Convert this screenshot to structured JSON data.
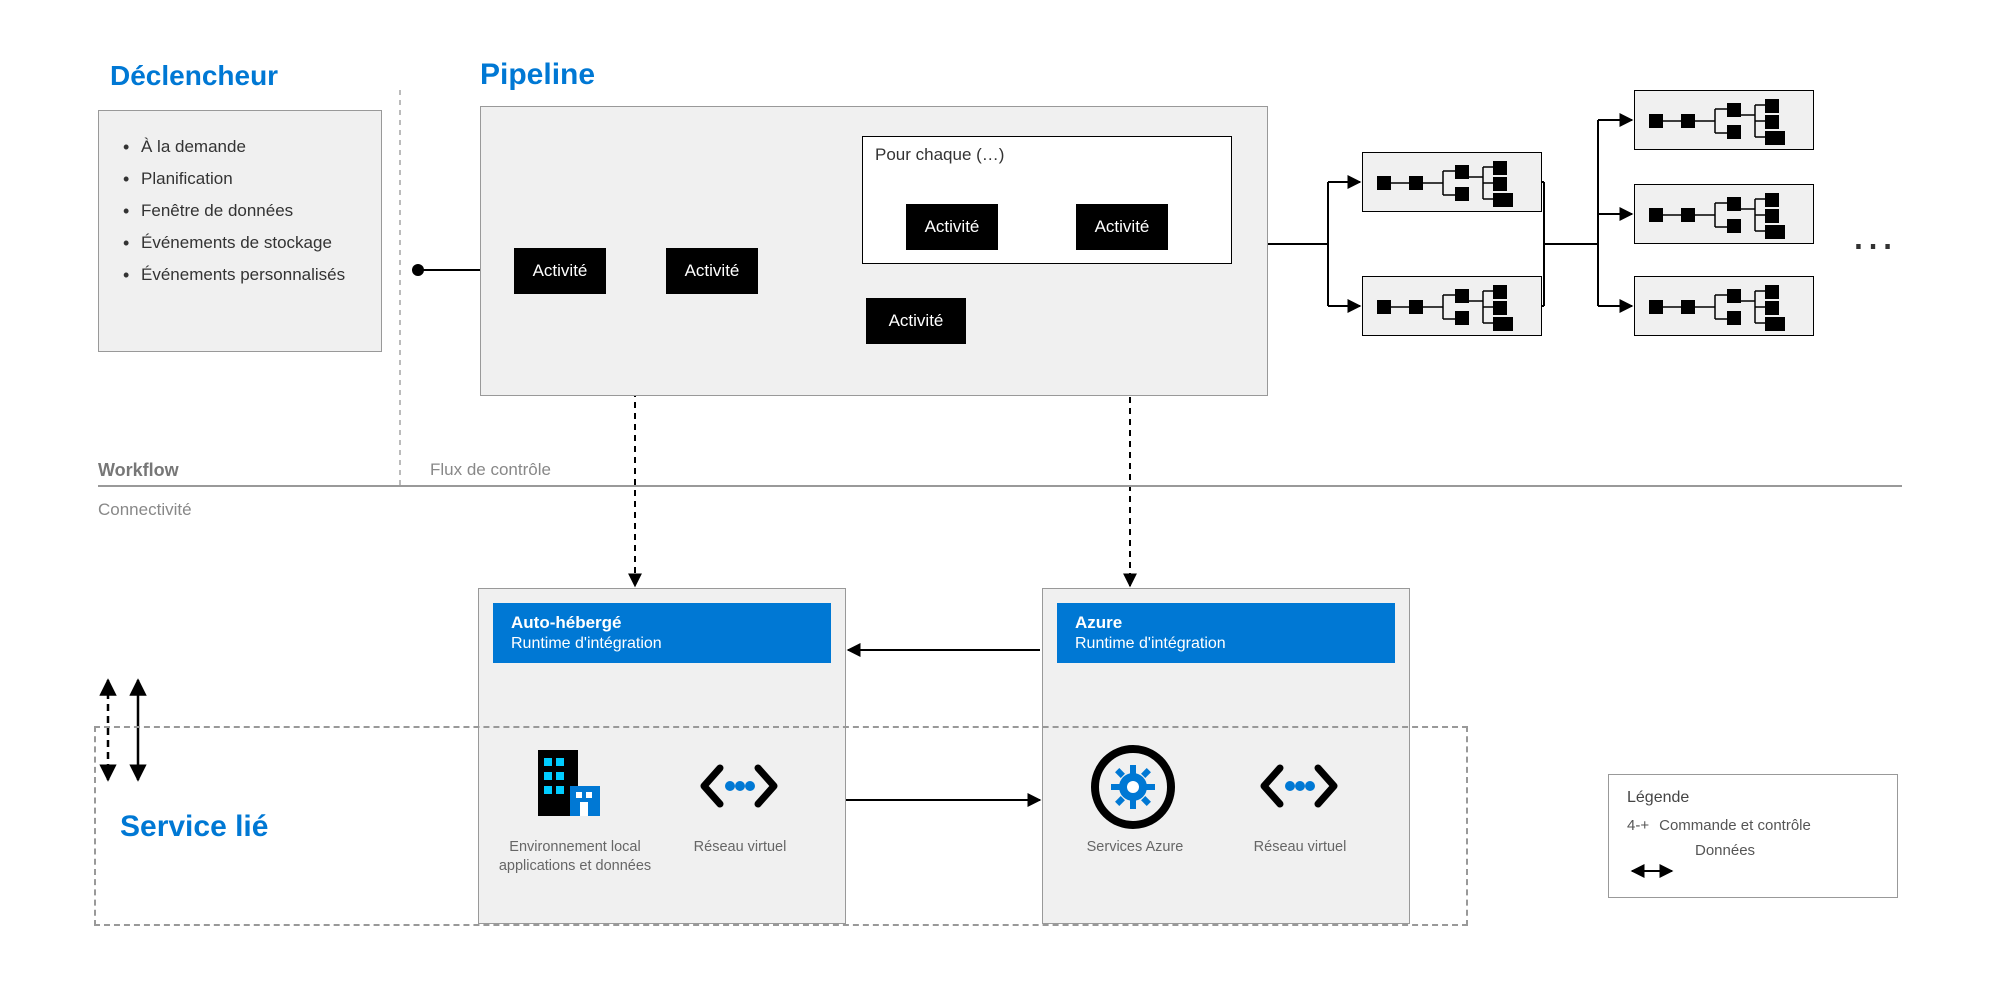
{
  "trigger": {
    "title": "Déclencheur",
    "items": [
      "À la demande",
      "Planification",
      "Fenêtre de données",
      "Événements de stockage",
      "Événements personnalisés"
    ]
  },
  "pipeline": {
    "title": "Pipeline",
    "activity_label": "Activité",
    "foreach_label": "Pour chaque (…)"
  },
  "sections": {
    "workflow": "Workflow",
    "flow_control": "Flux de contrôle",
    "connectivity": "Connectivité"
  },
  "selfhosted": {
    "title": "Auto-hébergé",
    "subtitle": "Runtime d'intégration",
    "env_label_1": "Environnement local",
    "env_label_2": "applications et données",
    "vnet_label": "Réseau virtuel"
  },
  "azure": {
    "title": "Azure",
    "subtitle": "Runtime d'intégration",
    "services_label": "Services Azure",
    "vnet_label": "Réseau virtuel"
  },
  "linked_service": {
    "title": "Service lié"
  },
  "legend": {
    "title": "Légende",
    "cmd": "Commande et contrôle",
    "cmd_prefix": "4-+",
    "data": "Données"
  },
  "ellipsis": "…"
}
